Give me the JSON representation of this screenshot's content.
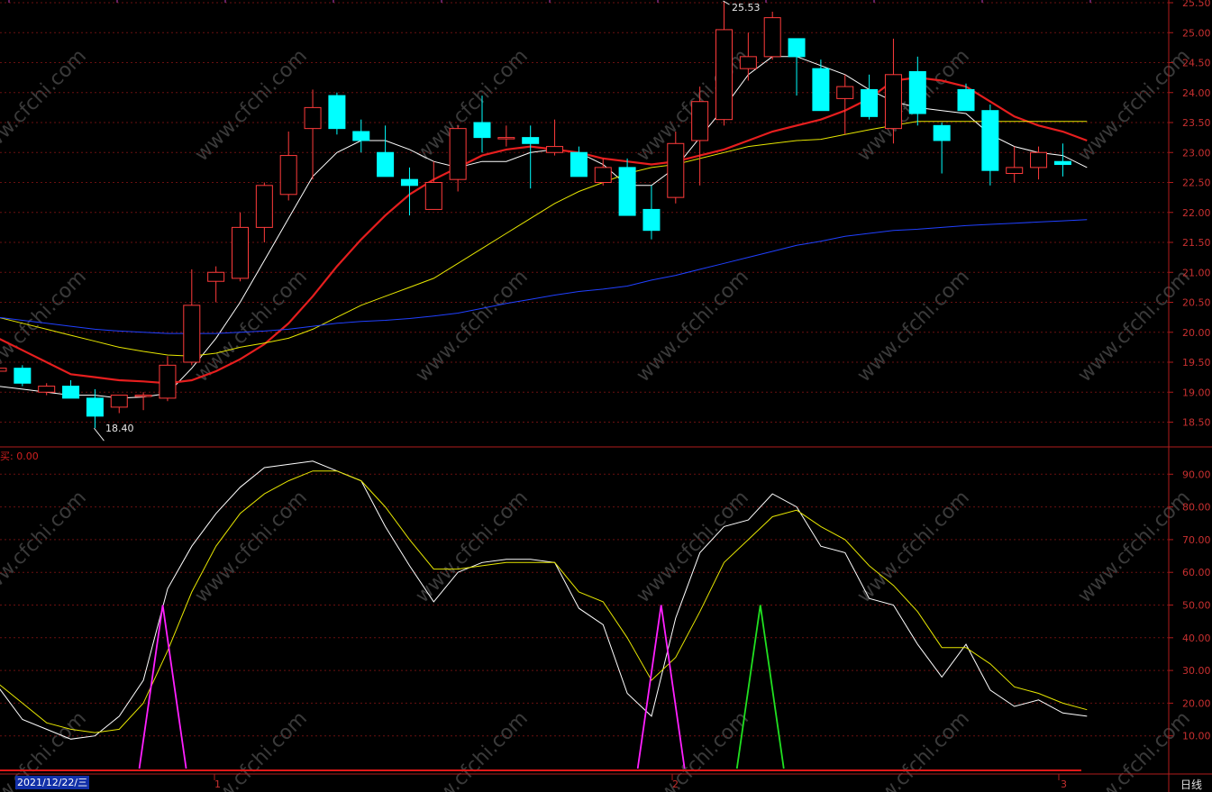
{
  "chart_data": [
    {
      "type": "candlestick",
      "name": "main",
      "y_ticks": [
        "25.50",
        "25.00",
        "24.50",
        "24.00",
        "23.50",
        "23.00",
        "22.50",
        "22.00",
        "21.50",
        "21.00",
        "20.50",
        "20.00",
        "19.50",
        "19.00",
        "18.50"
      ],
      "ylim": [
        18.0,
        25.5
      ],
      "annotations": {
        "high": "25.53",
        "low": "18.40"
      },
      "candles": [
        {
          "o": 19.35,
          "h": 19.45,
          "l": 19.15,
          "c": 19.4
        },
        {
          "o": 19.4,
          "h": 19.45,
          "l": 19.1,
          "c": 19.15
        },
        {
          "o": 19.0,
          "h": 19.15,
          "l": 18.95,
          "c": 19.1
        },
        {
          "o": 19.1,
          "h": 19.2,
          "l": 18.9,
          "c": 18.9
        },
        {
          "o": 18.9,
          "h": 19.05,
          "l": 18.4,
          "c": 18.6
        },
        {
          "o": 18.75,
          "h": 18.95,
          "l": 18.65,
          "c": 18.95
        },
        {
          "o": 18.95,
          "h": 19.0,
          "l": 18.7,
          "c": 18.95
        },
        {
          "o": 18.9,
          "h": 19.6,
          "l": 18.85,
          "c": 19.45
        },
        {
          "o": 19.5,
          "h": 21.05,
          "l": 19.45,
          "c": 20.45
        },
        {
          "o": 20.85,
          "h": 21.1,
          "l": 20.5,
          "c": 21.0
        },
        {
          "o": 20.9,
          "h": 22.0,
          "l": 20.85,
          "c": 21.75
        },
        {
          "o": 21.75,
          "h": 22.5,
          "l": 21.5,
          "c": 22.45
        },
        {
          "o": 22.3,
          "h": 23.35,
          "l": 22.2,
          "c": 22.95
        },
        {
          "o": 23.4,
          "h": 24.05,
          "l": 22.55,
          "c": 23.75
        },
        {
          "o": 23.95,
          "h": 24.0,
          "l": 23.3,
          "c": 23.4
        },
        {
          "o": 23.35,
          "h": 23.55,
          "l": 23.0,
          "c": 23.2
        },
        {
          "o": 23.0,
          "h": 23.45,
          "l": 22.65,
          "c": 22.6
        },
        {
          "o": 22.55,
          "h": 22.75,
          "l": 21.95,
          "c": 22.45
        },
        {
          "o": 22.05,
          "h": 22.85,
          "l": 22.05,
          "c": 22.5
        },
        {
          "o": 22.55,
          "h": 23.45,
          "l": 22.35,
          "c": 23.4
        },
        {
          "o": 23.5,
          "h": 23.95,
          "l": 23.0,
          "c": 23.25
        },
        {
          "o": 23.25,
          "h": 23.45,
          "l": 23.1,
          "c": 23.25
        },
        {
          "o": 23.25,
          "h": 23.45,
          "l": 22.4,
          "c": 23.15
        },
        {
          "o": 23.0,
          "h": 23.55,
          "l": 22.95,
          "c": 23.1
        },
        {
          "o": 23.0,
          "h": 23.1,
          "l": 22.6,
          "c": 22.6
        },
        {
          "o": 22.5,
          "h": 22.9,
          "l": 22.45,
          "c": 22.75
        },
        {
          "o": 22.75,
          "h": 22.9,
          "l": 21.95,
          "c": 21.95
        },
        {
          "o": 22.05,
          "h": 22.45,
          "l": 21.55,
          "c": 21.7
        },
        {
          "o": 22.25,
          "h": 23.35,
          "l": 22.15,
          "c": 23.15
        },
        {
          "o": 23.2,
          "h": 24.1,
          "l": 22.45,
          "c": 23.85
        },
        {
          "o": 23.55,
          "h": 25.53,
          "l": 23.45,
          "c": 25.05
        },
        {
          "o": 24.4,
          "h": 25.0,
          "l": 24.2,
          "c": 24.6
        },
        {
          "o": 24.6,
          "h": 25.35,
          "l": 24.55,
          "c": 25.25
        },
        {
          "o": 24.9,
          "h": 24.85,
          "l": 23.95,
          "c": 24.6
        },
        {
          "o": 24.4,
          "h": 24.55,
          "l": 23.75,
          "c": 23.7
        },
        {
          "o": 23.9,
          "h": 24.3,
          "l": 23.3,
          "c": 24.1
        },
        {
          "o": 24.05,
          "h": 24.3,
          "l": 23.55,
          "c": 23.6
        },
        {
          "o": 23.4,
          "h": 24.9,
          "l": 23.15,
          "c": 24.3
        },
        {
          "o": 24.35,
          "h": 24.6,
          "l": 23.45,
          "c": 23.65
        },
        {
          "o": 23.45,
          "h": 23.5,
          "l": 22.65,
          "c": 23.2
        },
        {
          "o": 24.05,
          "h": 24.15,
          "l": 23.7,
          "c": 23.7
        },
        {
          "o": 23.7,
          "h": 23.8,
          "l": 22.45,
          "c": 22.7
        },
        {
          "o": 22.65,
          "h": 23.1,
          "l": 22.5,
          "c": 22.75
        },
        {
          "o": 22.75,
          "h": 23.1,
          "l": 22.55,
          "c": 23.0
        },
        {
          "o": 22.85,
          "h": 23.15,
          "l": 22.6,
          "c": 22.8
        }
      ],
      "ma_lines": [
        {
          "color": "#ffffff",
          "values": [
            19.1,
            19.05,
            19.0,
            18.95,
            18.95,
            18.9,
            18.92,
            18.98,
            19.4,
            19.9,
            20.5,
            21.2,
            21.9,
            22.6,
            23.0,
            23.2,
            23.2,
            23.05,
            22.85,
            22.75,
            22.85,
            22.85,
            23.0,
            23.05,
            23.0,
            22.8,
            22.45,
            22.45,
            22.75,
            23.25,
            23.75,
            24.3,
            24.6,
            24.6,
            24.45,
            24.3,
            24.05,
            23.85,
            23.75,
            23.7,
            23.65,
            23.3,
            23.1,
            23.0,
            22.95,
            22.75
          ]
        },
        {
          "color": "#e61e1e",
          "values": [
            19.9,
            19.7,
            19.5,
            19.3,
            19.25,
            19.2,
            19.18,
            19.15,
            19.2,
            19.35,
            19.55,
            19.8,
            20.15,
            20.6,
            21.1,
            21.55,
            21.95,
            22.3,
            22.55,
            22.75,
            22.95,
            23.05,
            23.1,
            23.05,
            23.0,
            22.9,
            22.85,
            22.8,
            22.85,
            22.95,
            23.05,
            23.2,
            23.35,
            23.45,
            23.55,
            23.7,
            23.9,
            24.2,
            24.25,
            24.2,
            24.1,
            23.85,
            23.6,
            23.45,
            23.35,
            23.2
          ]
        },
        {
          "color": "#e6e600",
          "values": [
            20.25,
            20.15,
            20.05,
            19.95,
            19.85,
            19.75,
            19.68,
            19.62,
            19.6,
            19.65,
            19.75,
            19.82,
            19.9,
            20.05,
            20.25,
            20.45,
            20.6,
            20.75,
            20.9,
            21.15,
            21.4,
            21.65,
            21.9,
            22.15,
            22.35,
            22.5,
            22.65,
            22.75,
            22.8,
            22.9,
            23.0,
            23.1,
            23.15,
            23.2,
            23.22,
            23.3,
            23.38,
            23.45,
            23.52,
            23.52,
            23.52,
            23.52,
            23.52,
            23.52,
            23.52,
            23.52
          ]
        },
        {
          "color": "#2040ff",
          "values": [
            20.25,
            20.2,
            20.15,
            20.1,
            20.05,
            20.02,
            20.0,
            19.98,
            19.98,
            19.98,
            20.0,
            20.02,
            20.05,
            20.1,
            20.15,
            20.18,
            20.2,
            20.23,
            20.27,
            20.32,
            20.4,
            20.48,
            20.55,
            20.62,
            20.68,
            20.72,
            20.77,
            20.87,
            20.95,
            21.05,
            21.15,
            21.25,
            21.35,
            21.45,
            21.52,
            21.6,
            21.65,
            21.7,
            21.72,
            21.75,
            21.78,
            21.8,
            21.82,
            21.84,
            21.86,
            21.88
          ]
        }
      ]
    },
    {
      "type": "line",
      "name": "indicator",
      "label": "买: 0.00",
      "y_ticks": [
        "90.00",
        "80.00",
        "70.00",
        "60.00",
        "50.00",
        "40.00",
        "30.00",
        "20.00",
        "10.00"
      ],
      "ylim": [
        0,
        100
      ],
      "series": [
        {
          "color": "#ffffff",
          "values": [
            25,
            15,
            12,
            9,
            10,
            16,
            27,
            55,
            68,
            78,
            86,
            92,
            93,
            94,
            91,
            88,
            74,
            62,
            51,
            60,
            63,
            64,
            64,
            63,
            49,
            44,
            23,
            16,
            46,
            66,
            74,
            76,
            84,
            80,
            68,
            66,
            52,
            50,
            38,
            28,
            38,
            24,
            19,
            21,
            17,
            16
          ]
        },
        {
          "color": "#e6e600",
          "values": [
            26,
            20,
            14,
            12,
            11,
            12,
            20,
            36,
            54,
            68,
            78,
            84,
            88,
            91,
            91,
            88,
            80,
            70,
            61,
            61,
            62,
            63,
            63,
            63,
            54,
            51,
            40,
            27,
            34,
            48,
            63,
            70,
            77,
            79,
            74,
            70,
            62,
            56,
            48,
            37,
            37,
            32,
            25,
            23,
            20,
            18
          ]
        },
        {
          "color": "#ff20ff",
          "spikes": [
            {
              "i": 6.8,
              "v": 50
            },
            {
              "i": 27.4,
              "v": 50
            }
          ]
        },
        {
          "color": "#20e020",
          "spikes": [
            {
              "i": 31.5,
              "v": 50
            }
          ]
        }
      ]
    }
  ],
  "x_labels": {
    "date": "2021/12/22/三",
    "m1": "1",
    "m2": "2",
    "m3": "3",
    "period": "日线"
  },
  "watermark": "www.cfchi.com"
}
